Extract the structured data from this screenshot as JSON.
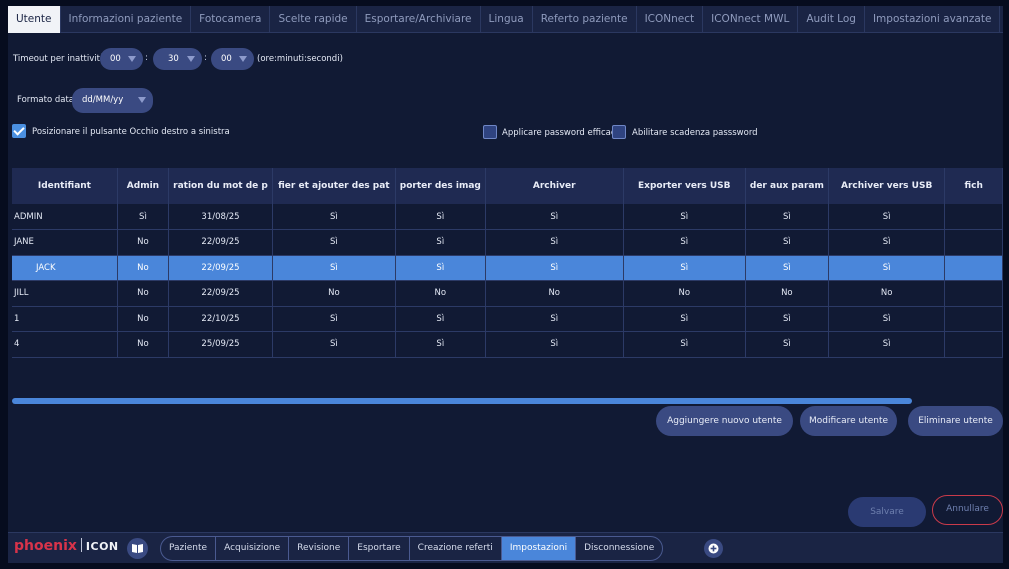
{
  "tabs": [
    "Utente",
    "Informazioni paziente",
    "Fotocamera",
    "Scelte rapide",
    "Esportare/Archiviare",
    "Lingua",
    "Referto paziente",
    "ICONnect",
    "ICONnect MWL",
    "Audit Log",
    "Impostazioni avanzate"
  ],
  "active_tab": "Utente",
  "timeout": {
    "label": "Timeout per inattività",
    "hours": "00",
    "minutes": "30",
    "seconds": "00",
    "sep1": ":",
    "sep2": ":",
    "hint": "(ore:minuti:secondi)"
  },
  "date_format": {
    "label": "Formato data",
    "value": "dd/MM/yy"
  },
  "options": {
    "right_eye_left": {
      "label": "Posizionare il pulsante Occhio destro a sinistra",
      "checked": true
    },
    "strong_password": {
      "label": "Applicare password efficace",
      "checked": false
    },
    "password_expiry": {
      "label": "Abilitare scadenza passsword",
      "checked": false
    }
  },
  "table": {
    "headers": [
      "Identifiant",
      "Admin",
      "ration du mot de p",
      "fier et ajouter des pat",
      "porter des imag",
      "Archiver",
      "Exporter vers USB",
      "der aux param",
      "Archiver vers USB",
      "fich"
    ],
    "rows": [
      [
        "ADMIN",
        "Sì",
        "31/08/25",
        "Sì",
        "Sì",
        "Sì",
        "Sì",
        "Sì",
        "Sì",
        ""
      ],
      [
        "JANE",
        "No",
        "22/09/25",
        "Sì",
        "Sì",
        "Sì",
        "Sì",
        "Sì",
        "Sì",
        ""
      ],
      [
        "JACK",
        "No",
        "22/09/25",
        "Sì",
        "Sì",
        "Sì",
        "Sì",
        "Sì",
        "Sì",
        ""
      ],
      [
        "JILL",
        "No",
        "22/09/25",
        "No",
        "No",
        "No",
        "No",
        "No",
        "No",
        ""
      ],
      [
        "1",
        "No",
        "22/10/25",
        "Sì",
        "Sì",
        "Sì",
        "Sì",
        "Sì",
        "Sì",
        ""
      ],
      [
        "4",
        "No",
        "25/09/25",
        "Sì",
        "Sì",
        "Sì",
        "Sì",
        "Sì",
        "Sì",
        ""
      ]
    ],
    "selected_row": 2
  },
  "actions": {
    "add": "Aggiungere nuovo utente",
    "edit": "Modificare utente",
    "delete": "Eliminare utente"
  },
  "footer_buttons": {
    "save": "Salvare",
    "cancel": "Annullare"
  },
  "brand": {
    "name": "phoenix",
    "product": "ICON"
  },
  "nav": [
    "Paziente",
    "Acquisizione",
    "Revisione",
    "Esportare",
    "Creazione referti",
    "Impostazioni",
    "Disconnessione"
  ],
  "active_nav": "Impostazioni",
  "colors": {
    "accent": "#4a86da",
    "panel": "#111a34",
    "control": "#3a4a82",
    "brand_red": "#d8334a"
  },
  "icons": [
    "checkmark-icon",
    "book-icon",
    "plus-icon",
    "chevron-down-icon"
  ]
}
